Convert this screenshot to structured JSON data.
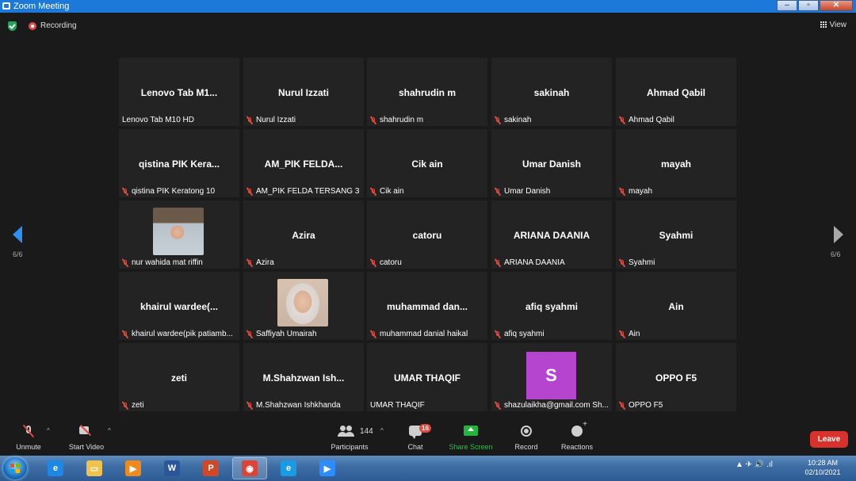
{
  "window": {
    "title": "Zoom Meeting",
    "min": "–",
    "max": "▫",
    "close": "✕"
  },
  "top": {
    "recording_label": "Recording",
    "view_label": "View"
  },
  "pagination": {
    "left_page": "6/6",
    "right_page": "6/6"
  },
  "tiles": [
    {
      "big": "Lenovo Tab M1...",
      "small": "Lenovo Tab M10 HD",
      "muted": false
    },
    {
      "big": "Nurul Izzati",
      "small": "Nurul Izzati",
      "muted": true
    },
    {
      "big": "shahrudin m",
      "small": "shahrudin m",
      "muted": true
    },
    {
      "big": "sakinah",
      "small": "sakinah",
      "muted": true
    },
    {
      "big": "Ahmad Qabil",
      "small": "Ahmad Qabil",
      "muted": true
    },
    {
      "big": "qistina PIK Kera...",
      "small": "qistina PIK Keratong 10",
      "muted": true
    },
    {
      "big": "AM_PIK FELDA...",
      "small": "AM_PIK FELDA TERSANG 3",
      "muted": true
    },
    {
      "big": "Cik ain",
      "small": "Cik ain",
      "muted": true
    },
    {
      "big": "Umar Danish",
      "small": "Umar Danish",
      "muted": true
    },
    {
      "big": "mayah",
      "small": "mayah",
      "muted": true
    },
    {
      "big": "",
      "small": "nur wahida mat riffin",
      "muted": true,
      "photo": "boy"
    },
    {
      "big": "Azira",
      "small": "Azira",
      "muted": true
    },
    {
      "big": "catoru",
      "small": "catoru",
      "muted": true
    },
    {
      "big": "ARIANA DAANIA",
      "small": "ARIANA DAANIA",
      "muted": true
    },
    {
      "big": "Syahmi",
      "small": "Syahmi",
      "muted": true
    },
    {
      "big": "khairul  wardee(...",
      "small": "khairul wardee(pik patiamb...",
      "muted": true
    },
    {
      "big": "",
      "small": "Saffiyah Umairah",
      "muted": true,
      "photo": "girl"
    },
    {
      "big": "muhammad  dan...",
      "small": "muhammad danial haikal",
      "muted": true
    },
    {
      "big": "afiq syahmi",
      "small": "afiq syahmi",
      "muted": true
    },
    {
      "big": "Ain",
      "small": "Ain",
      "muted": true
    },
    {
      "big": "zeti",
      "small": "zeti",
      "muted": true
    },
    {
      "big": "M.Shahzwan  Ish...",
      "small": "M.Shahzwan Ishkhanda",
      "muted": true
    },
    {
      "big": "UMAR THAQIF",
      "small": "UMAR THAQIF",
      "muted": false
    },
    {
      "big": "",
      "small": "shazulaikha@gmail.com Sh...",
      "muted": true,
      "letter": "S"
    },
    {
      "big": "OPPO F5",
      "small": "OPPO F5",
      "muted": true
    }
  ],
  "toolbar": {
    "unmute": "Unmute",
    "start_video": "Start Video",
    "participants": "Participants",
    "participants_count": "144",
    "chat": "Chat",
    "chat_badge": "16",
    "share_screen": "Share Screen",
    "record": "Record",
    "reactions": "Reactions",
    "leave": "Leave",
    "caret": "^"
  },
  "taskbar": {
    "apps": [
      {
        "name": "ie",
        "glyph": "e",
        "color": "#1e88e5"
      },
      {
        "name": "explorer",
        "glyph": "▭",
        "color": "#f0c24b"
      },
      {
        "name": "media-player",
        "glyph": "▶",
        "color": "#f08a1c"
      },
      {
        "name": "word",
        "glyph": "W",
        "color": "#2b579a"
      },
      {
        "name": "powerpoint",
        "glyph": "P",
        "color": "#d24726"
      },
      {
        "name": "chrome",
        "glyph": "◉",
        "color": "#db4437"
      },
      {
        "name": "edge",
        "glyph": "e",
        "color": "#1a9be6"
      },
      {
        "name": "zoom",
        "glyph": "▶",
        "color": "#2d8cff"
      }
    ],
    "tray": "▲  ✈  🔊  .ıl",
    "time": "10:28 AM",
    "date": "02/10/2021"
  }
}
